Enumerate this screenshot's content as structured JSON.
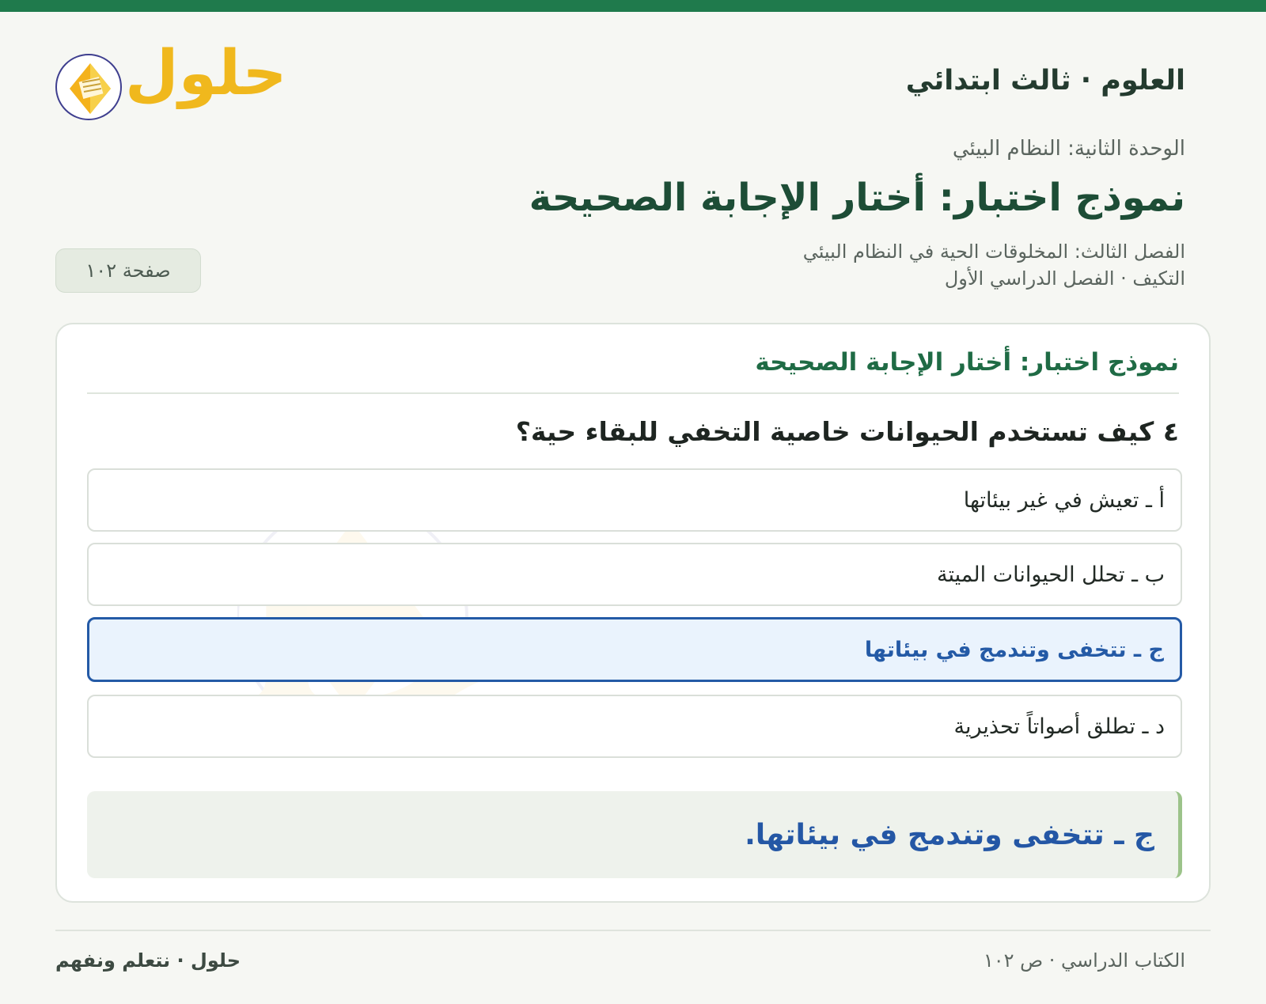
{
  "header": {
    "brand_title": "العلوم · ثالث ابتدائي",
    "logo_text": "حلول"
  },
  "unit": "الوحدة الثانية: النظام البيئي",
  "main_title": "نموذج اختبار: أختار الإجابة الصحيحة",
  "chapter": "الفصل الثالث: المخلوقات الحية في النظام البيئي",
  "lesson": "التكيف · الفصل الدراسي الأول",
  "page_badge": "صفحة ١٠٢",
  "card": {
    "title": "نموذج اختبار: أختار الإجابة الصحيحة",
    "question": "٤ كيف تستخدم الحيوانات خاصية التخفي للبقاء حية؟",
    "options": [
      {
        "label": "أ ـ تعيش في غير بيئاتها",
        "selected": false
      },
      {
        "label": "ب ـ تحلل الحيوانات الميتة",
        "selected": false
      },
      {
        "label": "ج ـ تتخفى وتندمج في بيئاتها",
        "selected": true
      },
      {
        "label": "د ـ تطلق أصواتاً تحذيرية",
        "selected": false
      }
    ],
    "answer": "ج ـ تتخفى وتندمج في بيئاتها."
  },
  "footer": {
    "right": "الكتاب الدراسي · ص ١٠٢",
    "left": "حلول · نتعلم ونفهم"
  },
  "colors": {
    "accent": "#1f7a4c",
    "selected": "#245aa6",
    "logo": "#f0b81d"
  }
}
